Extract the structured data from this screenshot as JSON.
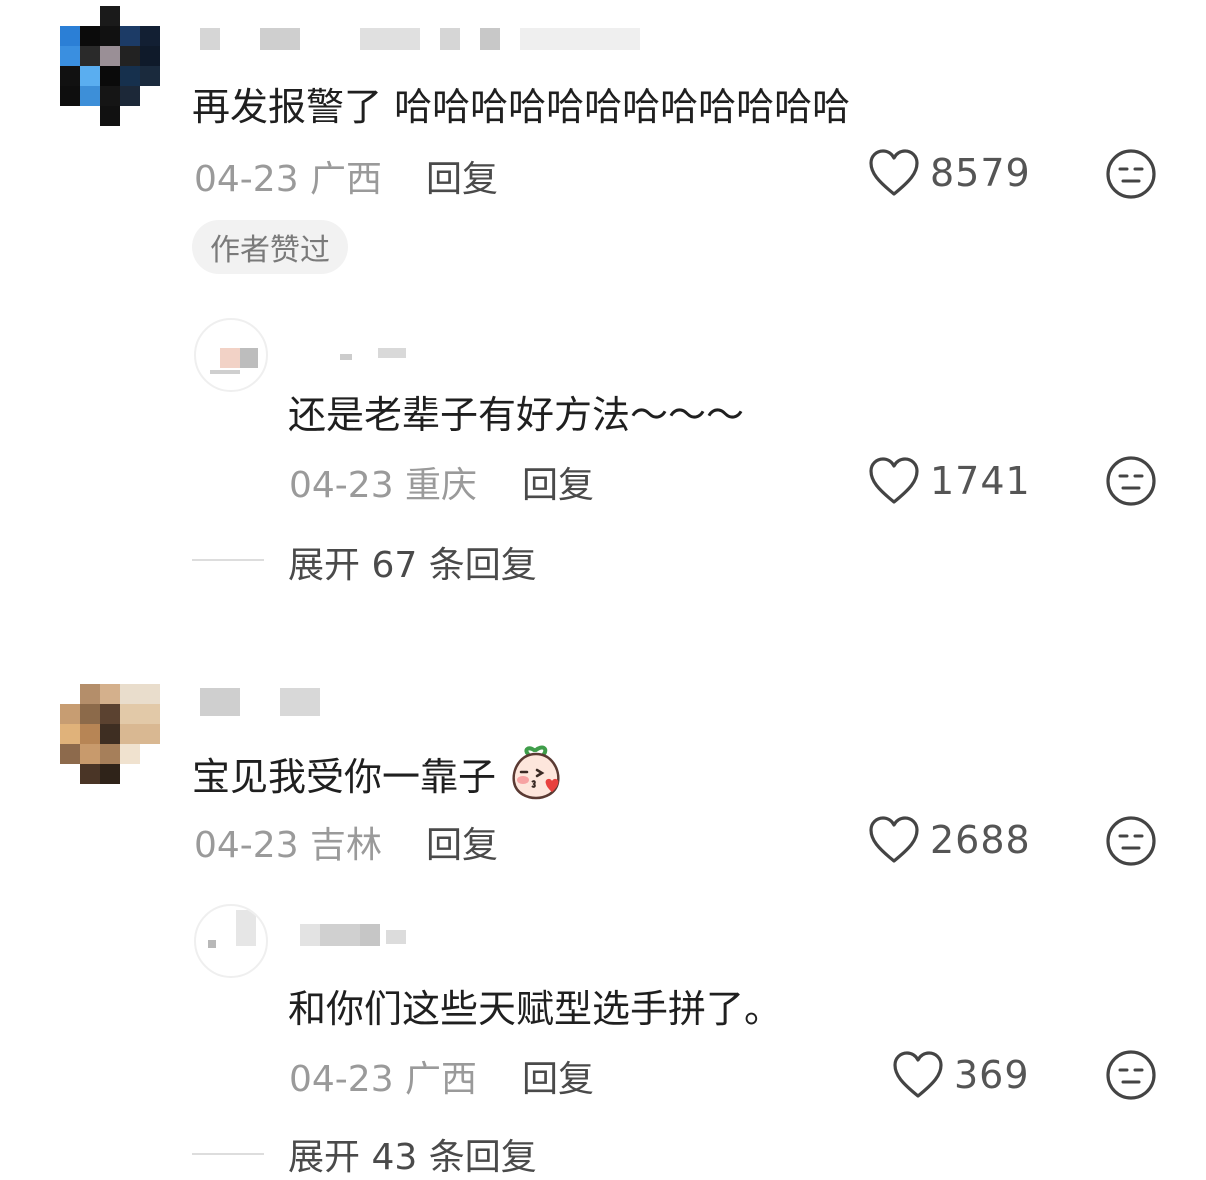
{
  "comments": [
    {
      "text": "再发报警了 哈哈哈哈哈哈哈哈哈哈哈哈",
      "date_location": "04-23 广西",
      "reply_label": "回复",
      "likes": "8579",
      "author_badge": "作者赞过",
      "replies": [
        {
          "text": "还是老辈子有好方法～～～",
          "date_location": "04-23 重庆",
          "reply_label": "回复",
          "likes": "1741"
        }
      ],
      "expand_label": "展开 67 条回复"
    },
    {
      "text": "宝见我受你一靠子",
      "date_location": "04-23 吉林",
      "reply_label": "回复",
      "likes": "2688",
      "replies": [
        {
          "text": "和你们这些天赋型选手拼了。",
          "date_location": "04-23 广西",
          "reply_label": "回复",
          "likes": "369"
        }
      ],
      "expand_label": "展开 43 条回复"
    }
  ],
  "icons": {
    "like": "heart-outline-icon",
    "dislike": "neutral-face-icon",
    "emoji": "kiss-peach-emoji"
  },
  "colors": {
    "text": "#1f1f1f",
    "meta": "#9a9a9a",
    "action": "#4a4a4a",
    "badge_bg": "#f2f2f2"
  }
}
